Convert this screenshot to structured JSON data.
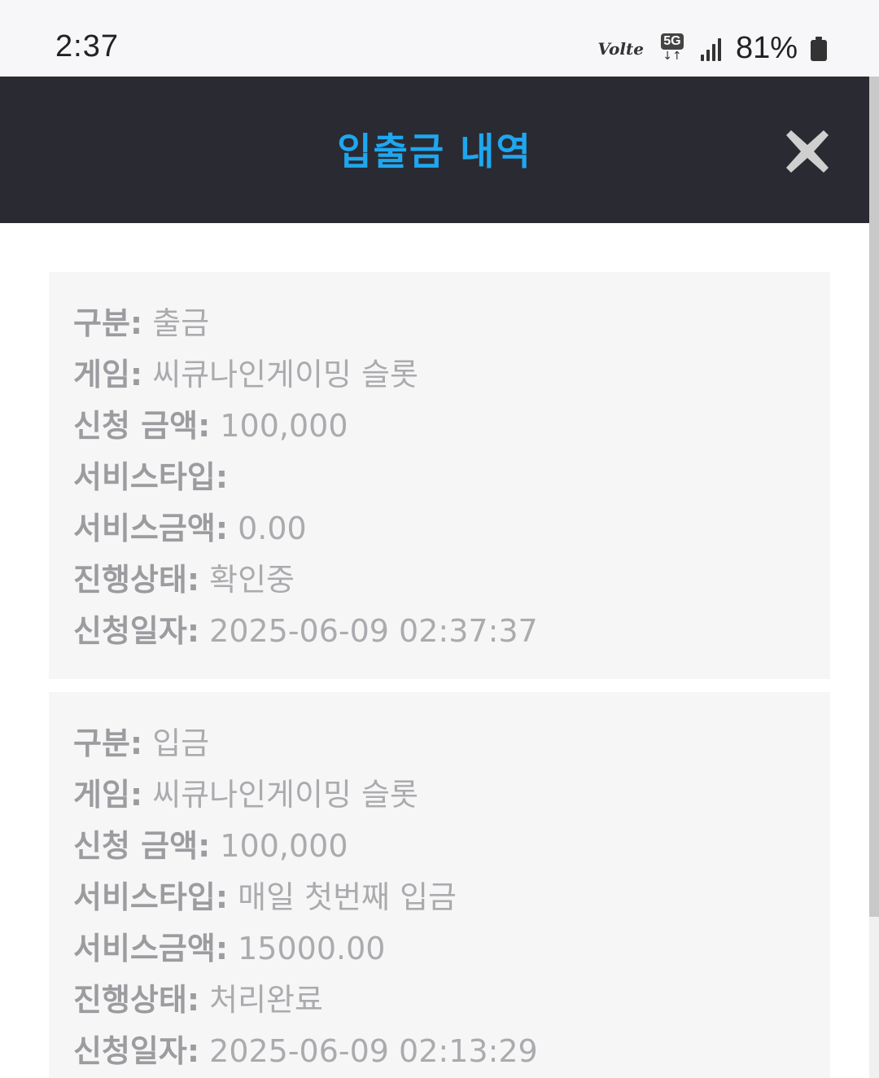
{
  "status_bar": {
    "time": "2:37",
    "volte": "Volte",
    "network": "5G",
    "battery": "81%"
  },
  "header": {
    "title": "입출금 내역",
    "close_icon": "close-x-icon"
  },
  "records": [
    {
      "type_label": "구분",
      "type": "출금",
      "game_label": "게임",
      "game": "씨큐나인게이밍 슬롯",
      "amount_label": "신청 금액",
      "amount": "100,000",
      "service_type_label": "서비스타입",
      "service_type": "",
      "service_amount_label": "서비스금액",
      "service_amount": "0.00",
      "status_label": "진행상태",
      "status": "확인중",
      "date_label": "신청일자",
      "date": "2025-06-09 02:37:37"
    },
    {
      "type_label": "구분",
      "type": "입금",
      "game_label": "게임",
      "game": "씨큐나인게이밍 슬롯",
      "amount_label": "신청 금액",
      "amount": "100,000",
      "service_type_label": "서비스타입",
      "service_type": "매일 첫번째 입금",
      "service_amount_label": "서비스금액",
      "service_amount": "15000.00",
      "status_label": "진행상태",
      "status": "처리완료",
      "date_label": "신청일자",
      "date": "2025-06-09 02:13:29"
    }
  ],
  "colors": {
    "header_bg": "#2a2a33",
    "title": "#1ea7ef",
    "card_bg": "#f6f6f6",
    "text": "#a9a9ad"
  }
}
